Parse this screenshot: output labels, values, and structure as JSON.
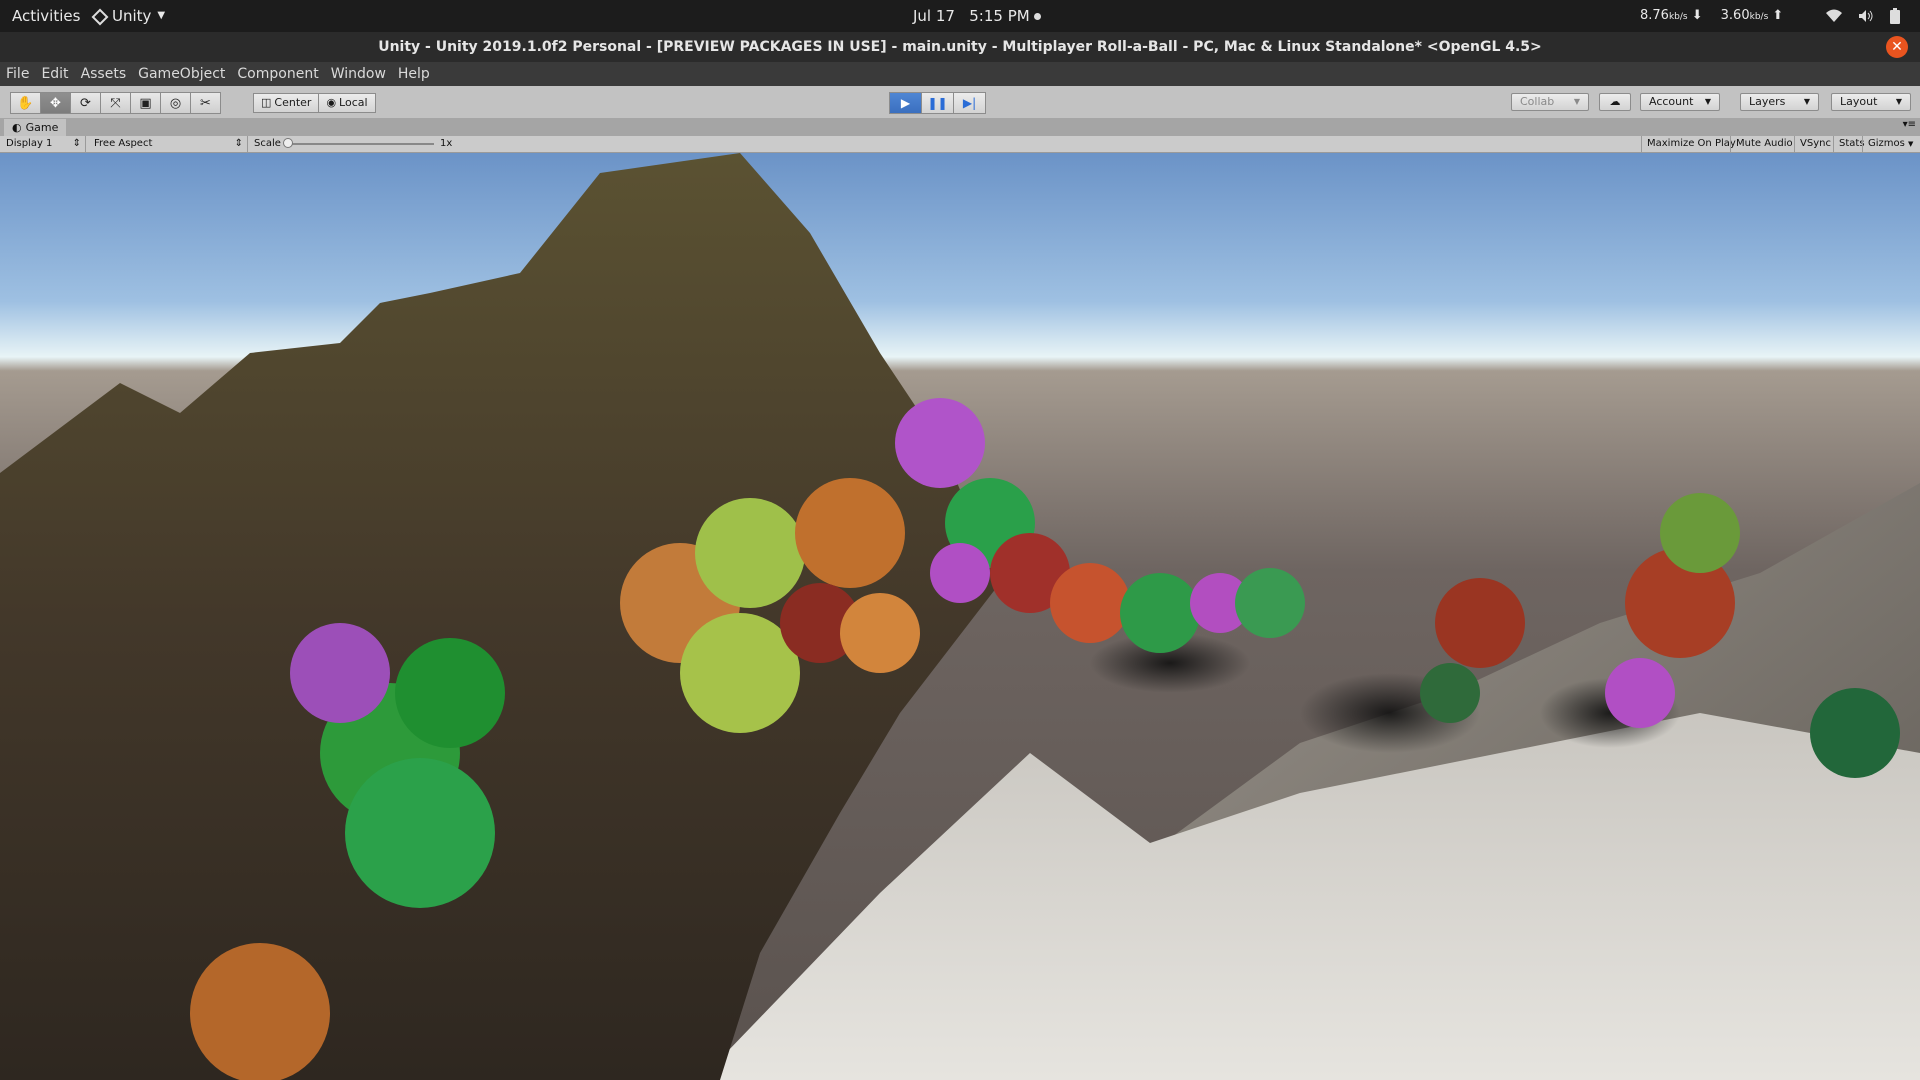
{
  "topbar": {
    "activities": "Activities",
    "app_name": "Unity",
    "date": "Jul 17",
    "time": "5:15 PM",
    "net_down": "8.76",
    "net_up": "3.60",
    "net_unit": "kb/s"
  },
  "window": {
    "title": "Unity - Unity 2019.1.0f2 Personal - [PREVIEW PACKAGES IN USE] - main.unity - Multiplayer Roll-a-Ball - PC, Mac & Linux Standalone* <OpenGL 4.5>"
  },
  "menu": [
    "File",
    "Edit",
    "Assets",
    "GameObject",
    "Component",
    "Window",
    "Help"
  ],
  "toolbar": {
    "pivot_label": "Center",
    "space_label": "Local",
    "collab_label": "Collab",
    "account_label": "Account",
    "layers_label": "Layers",
    "layout_label": "Layout"
  },
  "game_view": {
    "tab_label": "Game",
    "display_label": "Display 1",
    "aspect_label": "Free Aspect",
    "scale_label": "Scale",
    "scale_value": "1x",
    "scale_level": 0,
    "maximize_label": "Maximize On Play",
    "mute_label": "Mute Audio",
    "vsync_label": "VSync",
    "stats_label": "Stats",
    "gizmos_label": "Gizmos"
  },
  "colors": {
    "play_active": "#3b6fbf",
    "close_button": "#e9541f",
    "sky_top": "#6f96c8",
    "mountain": "#4a3f2a",
    "snow": "#d9d6d0"
  }
}
